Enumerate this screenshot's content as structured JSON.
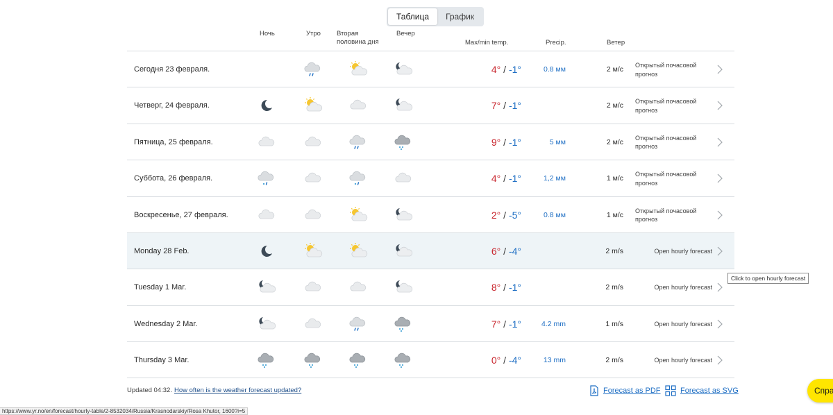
{
  "toggle": {
    "table": "Таблица",
    "chart": "График"
  },
  "headers": {
    "night": "Ночь",
    "morning": "Утро",
    "afternoon_1": "Вторая",
    "afternoon_2": "половина дня",
    "evening": "Вечер",
    "temp": "Max/min temp.",
    "precip": "Precip.",
    "wind": "Ветер"
  },
  "rows": [
    {
      "date": "Сегодня 23 февраля.",
      "icons": [
        "",
        "cloud-rain-icon",
        "sun-cloud-icon",
        "moon-cloud-icon"
      ],
      "max": "4°",
      "min": "-1°",
      "precip": "0.8 мм",
      "wind": "2 м/с",
      "link": "Открытый почасовой прогноз",
      "en": false
    },
    {
      "date": "Четверг, 24 февраля.",
      "icons": [
        "moon-icon",
        "sun-cloud-icon",
        "cloud-icon",
        "moon-cloud-icon"
      ],
      "max": "7°",
      "min": "-1°",
      "precip": "",
      "wind": "2 м/с",
      "link": "Открытый почасовой прогноз",
      "en": false
    },
    {
      "date": "Пятница, 25 февраля.",
      "icons": [
        "cloud-icon",
        "cloud-icon",
        "cloud-rain-icon",
        "dark-cloud-snow-icon"
      ],
      "max": "9°",
      "min": "-1°",
      "precip": "5 мм",
      "wind": "2 м/с",
      "link": "Открытый почасовой прогноз",
      "en": false
    },
    {
      "date": "Суббота, 26 февраля.",
      "icons": [
        "cloud-sleet-icon",
        "cloud-icon",
        "cloud-sleet-icon",
        "cloud-icon"
      ],
      "max": "4°",
      "min": "-1°",
      "precip": "1,2 мм",
      "wind": "1 м/с",
      "link": "Открытый почасовой прогноз",
      "en": false
    },
    {
      "date": "Воскресенье, 27 февраля.",
      "icons": [
        "cloud-icon",
        "cloud-icon",
        "sun-cloud-icon",
        "moon-cloud-icon"
      ],
      "max": "2°",
      "min": "-5°",
      "precip": "0.8 мм",
      "wind": "1 м/с",
      "link": "Открытый почасовой прогноз",
      "en": false
    },
    {
      "date": "Monday 28 Feb.",
      "icons": [
        "moon-icon",
        "sun-cloud-icon",
        "sun-cloud-icon",
        "moon-cloud-icon"
      ],
      "max": "6°",
      "min": "-4°",
      "precip": "",
      "wind": "2 m/s",
      "link": "Open hourly forecast",
      "en": true,
      "highlight": true
    },
    {
      "date": "Tuesday 1 Mar.",
      "icons": [
        "moon-cloud-icon",
        "cloud-icon",
        "cloud-icon",
        "moon-cloud-icon"
      ],
      "max": "8°",
      "min": "-1°",
      "precip": "",
      "wind": "2 m/s",
      "link": "Open hourly forecast",
      "en": true
    },
    {
      "date": "Wednesday 2 Mar.",
      "icons": [
        "moon-cloud-icon",
        "cloud-icon",
        "cloud-rain-icon",
        "dark-cloud-snow-icon"
      ],
      "max": "7°",
      "min": "-1°",
      "precip": "4.2 mm",
      "wind": "1 m/s",
      "link": "Open hourly forecast",
      "en": true
    },
    {
      "date": "Thursday 3 Mar.",
      "icons": [
        "dark-cloud-snow-icon",
        "dark-cloud-snow-icon",
        "dark-cloud-snow-icon",
        "dark-cloud-snow-icon"
      ],
      "max": "0°",
      "min": "-4°",
      "precip": "13 mm",
      "wind": "2 m/s",
      "link": "Open hourly forecast",
      "en": true
    }
  ],
  "tooltip": "Click to open hourly forecast",
  "footer": {
    "updated": "Updated 04:32.",
    "how_often": "How often is the weather forecast updated?",
    "pdf": "Forecast as PDF",
    "svg": "Forecast as SVG"
  },
  "status_url": "https://www.yr.no/en/forecast/hourly-table/2-8532034/Russia/Krasnodarskiy/Rosa Khutor, 1600?i=5",
  "help_label": "Справ"
}
